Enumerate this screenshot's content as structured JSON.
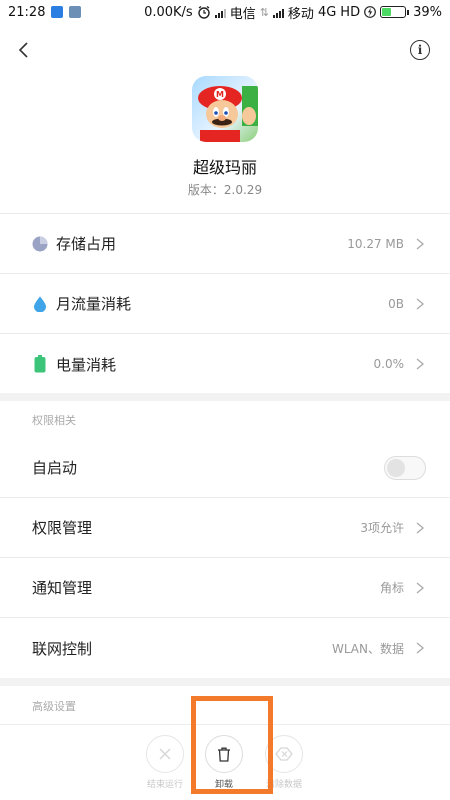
{
  "status_bar": {
    "time": "21:28",
    "net_speed": "0.00K/s",
    "carrier1": "电信",
    "carrier2": "移动",
    "network": "4G",
    "hd": "HD",
    "battery_percent": "39%",
    "battery_level": 0.39
  },
  "topbar": {
    "back_icon": "chevron-left-icon",
    "info_icon": "info-icon",
    "info_glyph": "i"
  },
  "app": {
    "name": "超级玛丽",
    "version": "版本：2.0.29"
  },
  "usage_rows": [
    {
      "label": "存储占用",
      "value": "10.27 MB",
      "icon": "pie-chart-icon",
      "color": "#9aa3c4"
    },
    {
      "label": "月流量消耗",
      "value": "0B",
      "icon": "water-drop-icon",
      "color": "#3fa5e8"
    },
    {
      "label": "电量消耗",
      "value": "0.0%",
      "icon": "battery-icon",
      "color": "#3cc47a"
    }
  ],
  "permissions": {
    "section_label": "权限相关",
    "autostart": {
      "label": "自启动",
      "enabled": false
    },
    "rows": [
      {
        "label": "权限管理",
        "value": "3项允许"
      },
      {
        "label": "通知管理",
        "value": "角标"
      },
      {
        "label": "联网控制",
        "value": "WLAN、数据"
      }
    ]
  },
  "advanced": {
    "section_label": "高级设置"
  },
  "actions": [
    {
      "label": "结束运行",
      "icon": "close-icon"
    },
    {
      "label": "卸载",
      "icon": "trash-icon"
    },
    {
      "label": "清除数据",
      "icon": "eraser-icon"
    }
  ],
  "colors": {
    "highlight": "#f47a2b",
    "switch_off": "#e3e3e3"
  }
}
